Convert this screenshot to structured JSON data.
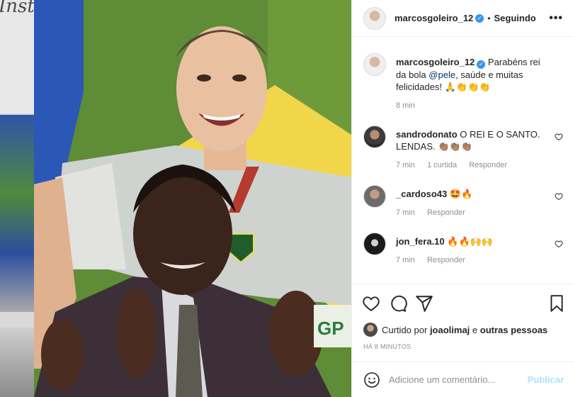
{
  "background": {
    "logo_fragment": "Insta"
  },
  "post": {
    "author": "marcosgoleiro_12",
    "follow_state": "Seguindo",
    "caption_prefix": "Parabéns rei da bola",
    "caption_mention": "@pele",
    "caption_suffix": ", saúde e muitas felicidades! 🙏👏👏👏",
    "caption_time": "8 min",
    "liked_by_prefix": "Curtido por",
    "liked_by_user": "joaolimaj",
    "liked_by_suffix": "e",
    "liked_by_others": "outras pessoas",
    "time_ago": "HÁ 8 MINUTOS"
  },
  "comments": [
    {
      "user": "sandrodonato",
      "text": "O REI E O SANTO. LENDAS. 👏🏽👏🏽👏🏽",
      "time": "7 min",
      "likes": "1 curtida",
      "reply": "Responder"
    },
    {
      "user": "_cardoso43",
      "text": "🤩🔥",
      "time": "7 min",
      "reply": "Responder"
    },
    {
      "user": "jon_fera.10",
      "text": "🔥🔥🙌🙌",
      "time": "7 min",
      "reply": "Responder"
    }
  ],
  "add_comment": {
    "placeholder": "Adicione um comentário...",
    "post_label": "Publicar"
  },
  "icons": {
    "like": "heart-icon",
    "comment": "comment-icon",
    "share": "share-icon",
    "save": "bookmark-icon",
    "emoji": "emoji-icon",
    "more": "more-options-icon",
    "verified": "verified-badge-icon"
  },
  "colors": {
    "link": "#00376b",
    "verified": "#3897f0",
    "publish_disabled": "#b2dffc",
    "muted": "#8e8e8e"
  }
}
